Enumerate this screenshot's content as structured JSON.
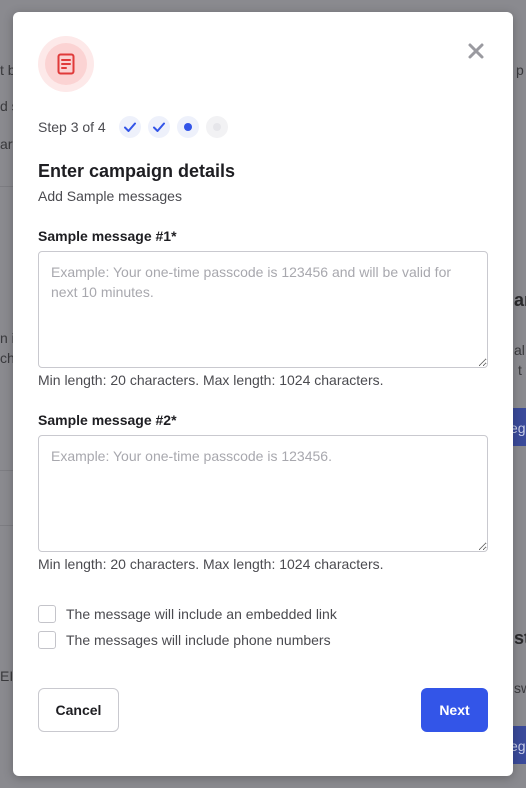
{
  "background": {
    "fragments_left": [
      "t b",
      "d s",
      "art",
      "n i",
      "ch",
      "EI"
    ],
    "fragments_right": [
      "p",
      "an",
      "al c",
      "t t",
      "eg",
      "st",
      "sw",
      "eg"
    ]
  },
  "modal": {
    "step": {
      "label": "Step 3 of 4",
      "current": 3,
      "total": 4
    },
    "title": "Enter campaign details",
    "subtitle": "Add Sample messages",
    "fields": [
      {
        "label": "Sample message #1*",
        "value": "",
        "placeholder": "Example: Your one-time passcode is 123456 and will be valid for next 10 minutes.",
        "hint": "Min length: 20 characters. Max length: 1024 characters."
      },
      {
        "label": "Sample message #2*",
        "value": "",
        "placeholder": "Example: Your one-time passcode is 123456.",
        "hint": "Min length: 20 characters. Max length: 1024 characters."
      }
    ],
    "checkboxes": [
      {
        "label": "The message will include an embedded link",
        "checked": false
      },
      {
        "label": "The messages will include phone numbers",
        "checked": false
      }
    ],
    "buttons": {
      "cancel": "Cancel",
      "next": "Next"
    },
    "icons": {
      "header": "document-icon",
      "close": "close-icon",
      "step_done": "check-icon"
    },
    "colors": {
      "accent": "#3355e8",
      "icon_bg": "#fde9e9",
      "icon_fg": "#e03a3a"
    }
  }
}
